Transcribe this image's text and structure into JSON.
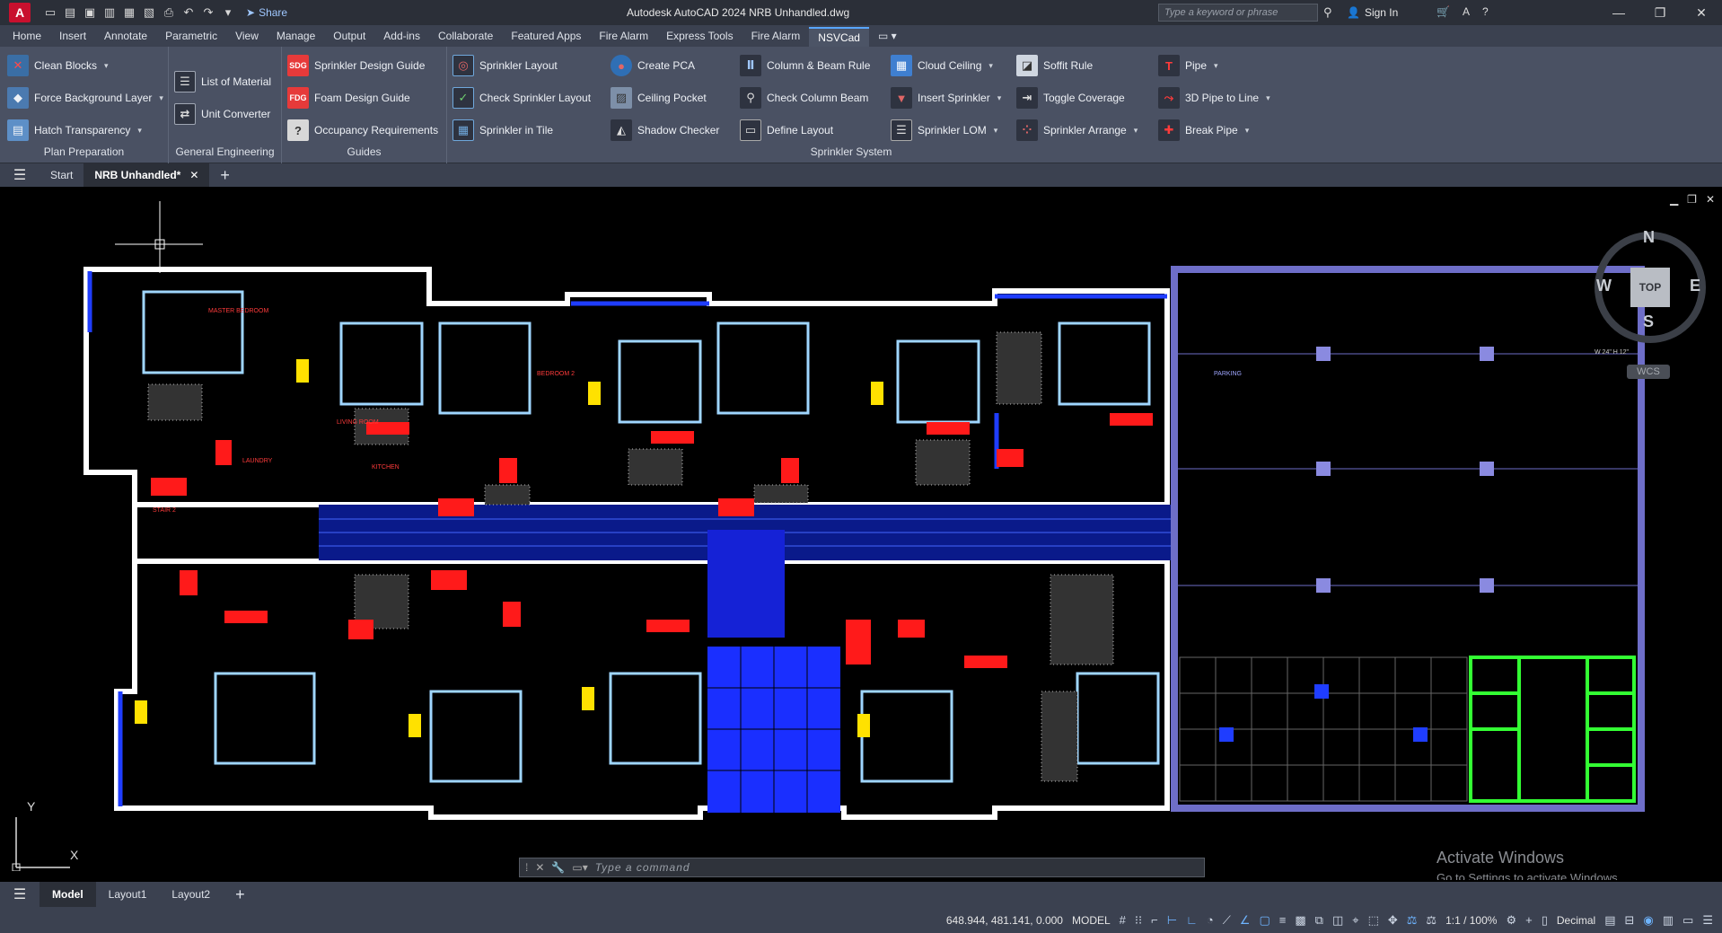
{
  "app": {
    "logo": "A",
    "title": "Autodesk AutoCAD 2024   NRB Unhandled.dwg",
    "share": "Share",
    "search_placeholder": "Type a keyword or phrase",
    "sign_in": "Sign In"
  },
  "ribbon_tabs": [
    "Home",
    "Insert",
    "Annotate",
    "Parametric",
    "View",
    "Manage",
    "Output",
    "Add-ins",
    "Collaborate",
    "Featured Apps",
    "Fire Alarm",
    "Express Tools",
    "Fire Alarm",
    "NSVCad"
  ],
  "active_tab": "NSVCad",
  "ribbon": {
    "plan_preparation": {
      "label": "Plan Preparation",
      "items": [
        "Clean Blocks",
        "Force Background Layer",
        "Hatch Transparency"
      ]
    },
    "general_engineering": {
      "label": "General Engineering",
      "items": [
        "List of Material",
        "Unit Converter"
      ]
    },
    "guides": {
      "label": "Guides",
      "items": [
        "Sprinkler Design Guide",
        "Foam Design Guide",
        "Occupancy Requirements"
      ],
      "icon_text": [
        "SDG",
        "FDG",
        ""
      ]
    },
    "sprinkler_system": {
      "label": "Sprinkler System",
      "col1": [
        "Sprinkler Layout",
        "Check Sprinkler Layout",
        "Sprinkler in Tile"
      ],
      "col2": [
        "Create PCA",
        "Ceiling Pocket",
        "Shadow Checker"
      ],
      "col3": [
        "Column & Beam Rule",
        "Check Column  Beam",
        "Define Layout"
      ],
      "col4": [
        "Cloud Ceiling",
        "Insert Sprinkler",
        "Sprinkler LOM"
      ],
      "col5": [
        "Soffit Rule",
        "Toggle Coverage",
        "Sprinkler Arrange"
      ],
      "col6": [
        "Pipe",
        "3D Pipe to Line",
        "Break Pipe"
      ]
    }
  },
  "file_tabs": {
    "start": "Start",
    "current": "NRB Unhandled*"
  },
  "viewcube": {
    "top": "TOP",
    "n": "N",
    "s": "S",
    "e": "E",
    "w": "W",
    "wcs": "WCS"
  },
  "ucs": {
    "x": "X",
    "y": "Y"
  },
  "drawing": {
    "parking_label": "PARKING",
    "room_labels": [
      "MASTER BEDROOM",
      "LIVING ROOM",
      "KITCHEN",
      "BEDROOM 2",
      "LAUNDRY",
      "STAIR 2"
    ],
    "dim_label": "W 24\" H 12\""
  },
  "command_line": {
    "placeholder": "Type  a  command"
  },
  "layout_tabs": [
    "Model",
    "Layout1",
    "Layout2"
  ],
  "activate_windows": {
    "title": "Activate Windows",
    "subtitle": "Go to Settings to activate Windows."
  },
  "status": {
    "coords": "648.944, 481.141, 0.000",
    "space": "MODEL",
    "scale": "1:1 / 100%",
    "units": "Decimal"
  },
  "colors": {
    "accent": "#58a6ff",
    "wall": "#ffffff",
    "blue": "#1f3dff",
    "red": "#ff1a1a",
    "green": "#33ff33",
    "cyan": "#7fd8ff"
  }
}
